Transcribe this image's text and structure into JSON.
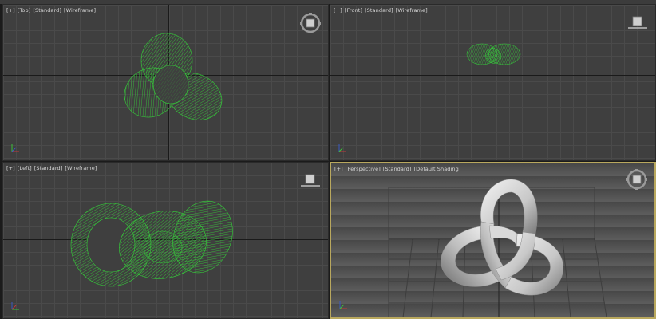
{
  "viewports": {
    "top": {
      "plus": "[+]",
      "view": "[Top]",
      "mode": "[Standard]",
      "shading": "[Wireframe]"
    },
    "front": {
      "plus": "[+]",
      "view": "[Front]",
      "mode": "[Standard]",
      "shading": "[Wireframe]"
    },
    "left": {
      "plus": "[+]",
      "view": "[Left]",
      "mode": "[Standard]",
      "shading": "[Wireframe]"
    },
    "perspective": {
      "plus": "[+]",
      "view": "[Perspective]",
      "mode": "[Standard]",
      "shading": "[Default Shading]"
    }
  },
  "icons": {
    "viewcube": "viewcube-icon",
    "axis_triad": "axis-tripod-icon"
  },
  "colors": {
    "wireframe": "#35d13a",
    "active_border": "#b9a85e",
    "viewport_bg": "#3f3f3f"
  },
  "active_viewport": "perspective"
}
